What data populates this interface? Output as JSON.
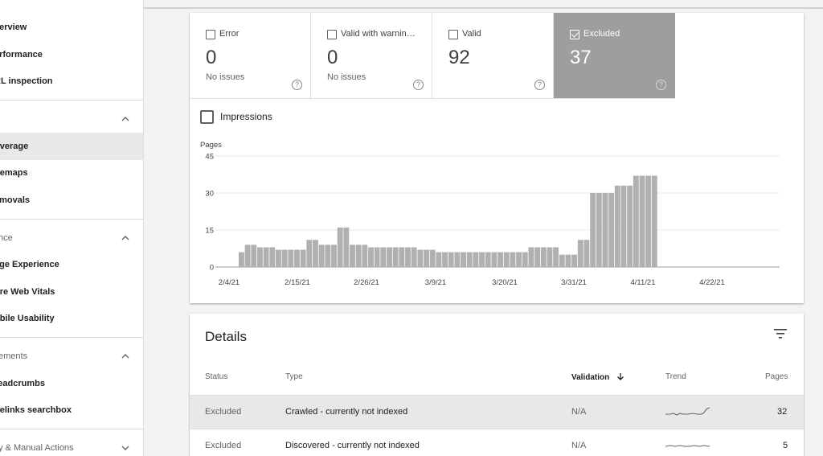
{
  "sidebar": {
    "items": [
      {
        "label": "Overview",
        "type": "item",
        "top": 17
      },
      {
        "label": "Performance",
        "type": "item",
        "top": 51
      },
      {
        "label": "URL inspection",
        "type": "item",
        "top": 84
      },
      {
        "label": "",
        "type": "section",
        "top": 131
      },
      {
        "label": "Coverage",
        "type": "item",
        "top": 165,
        "active": true
      },
      {
        "label": "Sitemaps",
        "type": "item",
        "top": 198
      },
      {
        "label": "Removals",
        "type": "item",
        "top": 232
      },
      {
        "label": "Experience",
        "type": "section",
        "top": 279
      },
      {
        "label": "Page Experience",
        "type": "item",
        "top": 312
      },
      {
        "label": "Core Web Vitals",
        "type": "item",
        "top": 346
      },
      {
        "label": "Mobile Usability",
        "type": "item",
        "top": 379
      },
      {
        "label": "Enhancements",
        "type": "section",
        "top": 426
      },
      {
        "label": "Breadcrumbs",
        "type": "item",
        "top": 460
      },
      {
        "label": "Sitelinks searchbox",
        "type": "item",
        "top": 493
      },
      {
        "label": "Security & Manual Actions",
        "type": "section-collapsed",
        "top": 540
      }
    ],
    "visible_labels": {
      "overview": "verview",
      "performance": "erformance",
      "url_inspection": "RL inspection",
      "coverage": "overage",
      "sitemaps": "itemaps",
      "removals": "emovals",
      "experience": "nce",
      "page_experience": "age Experience",
      "core_web_vitals": "ore Web Vitals",
      "mobile_usability": "obile Usability",
      "enhancements": "ements",
      "breadcrumbs": "readcrumbs",
      "sitelinks": "itelinks searchbox",
      "security": "y & Manual Actions"
    }
  },
  "coverage": {
    "tiles": [
      {
        "title": "Error",
        "count": "0",
        "sub": "No issues",
        "selected": false
      },
      {
        "title": "Valid with warnin…",
        "count": "0",
        "sub": "No issues",
        "selected": false
      },
      {
        "title": "Valid",
        "count": "92",
        "sub": "",
        "selected": false
      },
      {
        "title": "Excluded",
        "count": "37",
        "sub": "",
        "selected": true
      }
    ],
    "impressions_label": "Impressions",
    "help_glyph": "?"
  },
  "chart_data": {
    "type": "bar",
    "ylabel": "Pages",
    "ylim": [
      0,
      45
    ],
    "yticks": [
      "45",
      "30",
      "15",
      "0"
    ],
    "xtick_labels": [
      "2/4/21",
      "2/15/21",
      "2/26/21",
      "3/9/21",
      "3/20/21",
      "3/31/21",
      "4/11/21",
      "4/22/21"
    ],
    "bar_color": "#b0b0b0",
    "series": [
      {
        "values": [
          6,
          9,
          9,
          8,
          8,
          8,
          7,
          7,
          7,
          7,
          7,
          11,
          11,
          9,
          9,
          9,
          16,
          16,
          9,
          9,
          9,
          8,
          8,
          8,
          8,
          8,
          8,
          8,
          8,
          7,
          7,
          7,
          6,
          6,
          6,
          6,
          6,
          6,
          6,
          6,
          6,
          6,
          6,
          6,
          6,
          6,
          6,
          8,
          8,
          8,
          8,
          8,
          5,
          5,
          5,
          11,
          11,
          30,
          30,
          30,
          30,
          33,
          33,
          33,
          37,
          37,
          37,
          37
        ]
      }
    ]
  },
  "details": {
    "title": "Details",
    "headers": {
      "status": "Status",
      "type": "Type",
      "validation": "Validation",
      "trend": "Trend",
      "pages": "Pages"
    },
    "rows": [
      {
        "status": "Excluded",
        "type": "Crawled - currently not indexed",
        "validation": "N/A",
        "pages": "32",
        "highlight": true
      },
      {
        "status": "Excluded",
        "type": "Discovered - currently not indexed",
        "validation": "N/A",
        "pages": "5",
        "highlight": false
      }
    ]
  }
}
